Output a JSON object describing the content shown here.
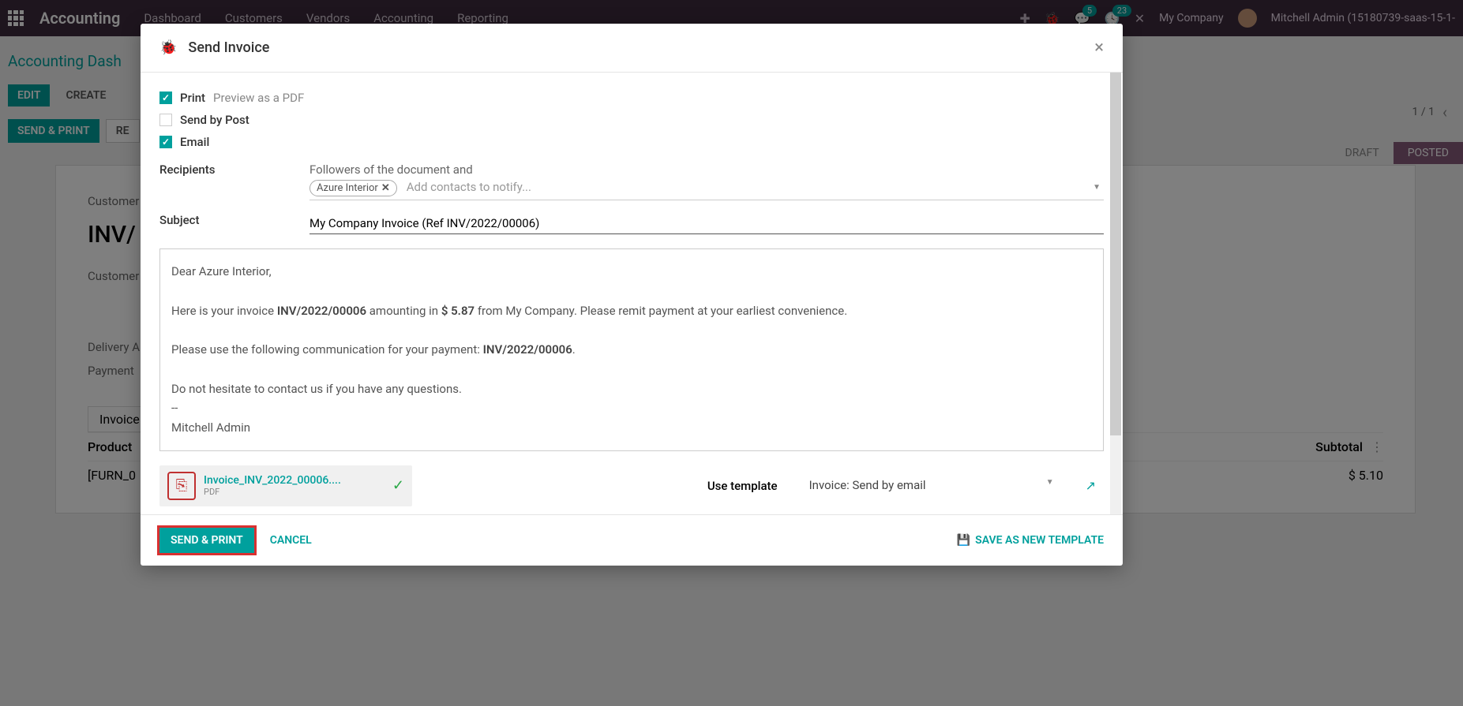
{
  "topbar": {
    "brand": "Accounting",
    "nav": [
      "Dashboard",
      "Customers",
      "Vendors",
      "Accounting",
      "Reporting"
    ],
    "badge1": "5",
    "badge2": "23",
    "company": "My Company",
    "user": "Mitchell Admin (15180739-saas-15-1-"
  },
  "page": {
    "breadcrumb": "Accounting Dash",
    "edit": "EDIT",
    "create": "CREATE",
    "send_print": "SEND & PRINT",
    "re": "RE",
    "pager": "1 / 1",
    "draft": "DRAFT",
    "posted": "POSTED",
    "customer_label": "Customer",
    "inv_prefix": "INV/",
    "delivery": "Delivery A",
    "payment": "Payment",
    "tab_invoice": "Invoice",
    "product_col": "Product",
    "subtotal_col": "Subtotal",
    "line_product": "[FURN_0",
    "line_subtotal": "$ 5.10"
  },
  "modal": {
    "title": "Send Invoice",
    "print": "Print",
    "print_hint": "Preview as a PDF",
    "send_by_post": "Send by Post",
    "email": "Email",
    "recipients_label": "Recipients",
    "followers_text": "Followers of the document and",
    "tag": "Azure Interior",
    "add_contacts": "Add contacts to notify...",
    "subject_label": "Subject",
    "subject_value": "My Company Invoice (Ref INV/2022/00006)",
    "body": {
      "greeting": "Dear Azure Interior,",
      "l1a": "Here is your invoice ",
      "l1_inv": "INV/2022/00006",
      "l1b": " amounting in ",
      "l1_amt": "$ 5.87",
      "l1c": " from My Company. Please remit payment at your earliest convenience.",
      "l2a": "Please use the following communication for your payment: ",
      "l2_ref": "INV/2022/00006",
      "l2b": ".",
      "l3": "Do not hesitate to contact us if you have any questions.",
      "sig_sep": "--",
      "sig_name": "Mitchell Admin"
    },
    "attachment_name": "Invoice_INV_2022_00006....",
    "attachment_type": "PDF",
    "use_template_label": "Use template",
    "template_value": "Invoice: Send by email",
    "send_print_btn": "SEND & PRINT",
    "cancel": "CANCEL",
    "save_template": "SAVE AS NEW TEMPLATE"
  }
}
